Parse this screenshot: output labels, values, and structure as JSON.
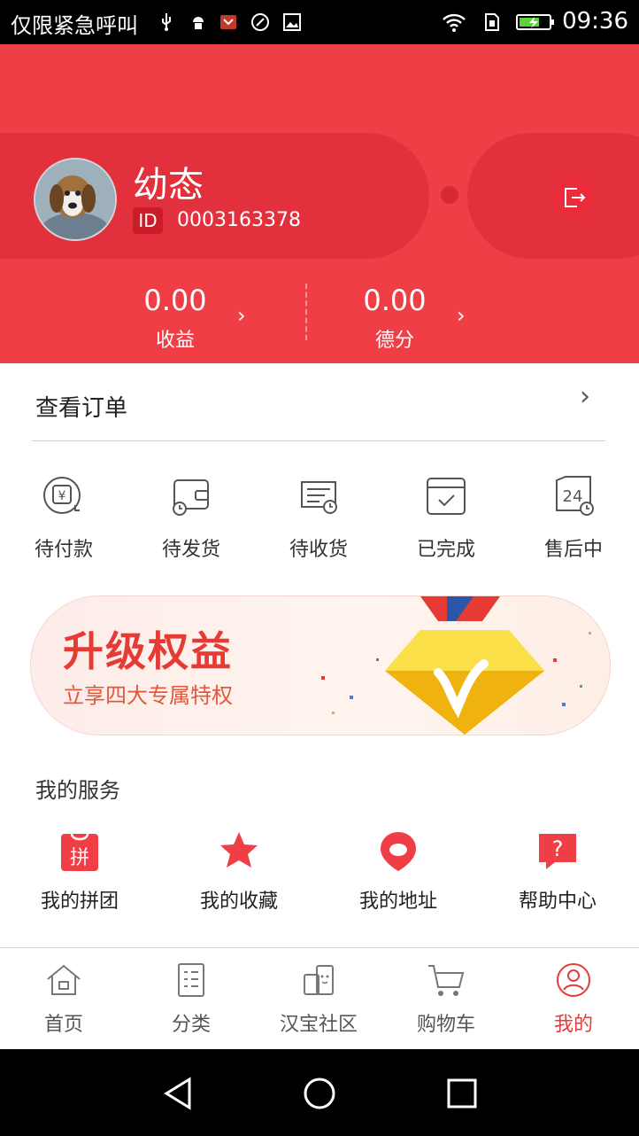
{
  "status_bar": {
    "left_text": "仅限紧急呼叫",
    "time": "09:36",
    "icons": [
      "usb-icon",
      "android-icon",
      "app-notification-icon",
      "sync-icon",
      "image-icon",
      "wifi-icon",
      "sim-icon",
      "battery-charging-icon"
    ]
  },
  "profile": {
    "username": "幼态",
    "id_label": "ID",
    "id_number": "0003163378"
  },
  "stats": [
    {
      "value": "0.00",
      "label": "收益"
    },
    {
      "value": "0.00",
      "label": "德分"
    }
  ],
  "orders": {
    "title": "查看订单",
    "items": [
      {
        "label": "待付款",
        "icon": "payment-pending-icon"
      },
      {
        "label": "待发货",
        "icon": "wallet-clock-icon"
      },
      {
        "label": "待收货",
        "icon": "receipt-clock-icon"
      },
      {
        "label": "已完成",
        "icon": "calendar-check-icon"
      },
      {
        "label": "售后中",
        "icon": "after-sale-24-icon"
      }
    ]
  },
  "banner": {
    "title": "升级权益",
    "subtitle": "立享四大专属特权"
  },
  "services": {
    "title": "我的服务",
    "items": [
      {
        "label": "我的拼团",
        "icon": "group-buy-icon",
        "badge": "拼"
      },
      {
        "label": "我的收藏",
        "icon": "star-icon"
      },
      {
        "label": "我的地址",
        "icon": "location-pin-icon"
      },
      {
        "label": "帮助中心",
        "icon": "help-icon",
        "badge": "?"
      }
    ]
  },
  "bottom_nav": {
    "items": [
      {
        "label": "首页",
        "icon": "home-icon"
      },
      {
        "label": "分类",
        "icon": "category-list-icon"
      },
      {
        "label": "汉宝社区",
        "icon": "community-icon"
      },
      {
        "label": "购物车",
        "icon": "cart-icon"
      },
      {
        "label": "我的",
        "icon": "profile-icon",
        "active": true
      }
    ]
  },
  "colors": {
    "header_red": "#ef3e46",
    "pill_red": "#e2303c",
    "accent": "#e33c3c"
  }
}
